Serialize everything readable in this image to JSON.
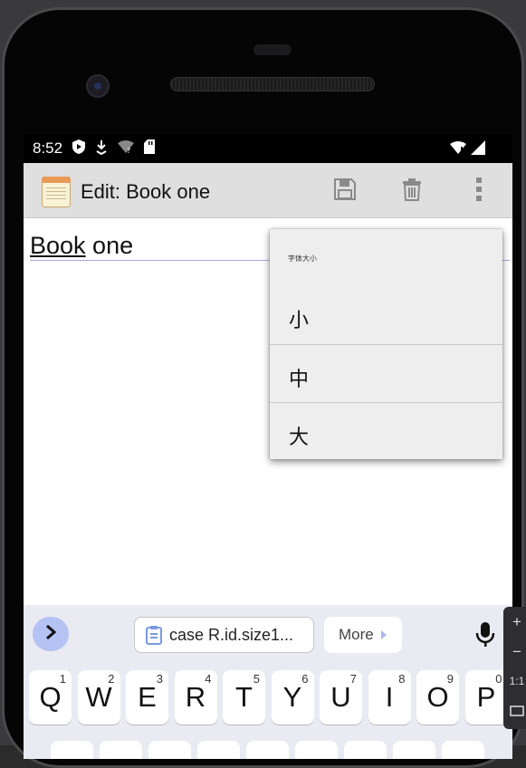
{
  "status_bar": {
    "time": "8:52"
  },
  "app_bar": {
    "title": "Edit: Book one"
  },
  "editor": {
    "title_underlined": "Book",
    "title_rest": " one"
  },
  "popup": {
    "title": "字体大小",
    "options": [
      "小",
      "中",
      "大"
    ]
  },
  "keyboard": {
    "clipboard_text": "case R.id.size1...",
    "more_label": "More",
    "keys": [
      {
        "letter": "Q",
        "hint": "1"
      },
      {
        "letter": "W",
        "hint": "2"
      },
      {
        "letter": "E",
        "hint": "3"
      },
      {
        "letter": "R",
        "hint": "4"
      },
      {
        "letter": "T",
        "hint": "5"
      },
      {
        "letter": "Y",
        "hint": "6"
      },
      {
        "letter": "U",
        "hint": "7"
      },
      {
        "letter": "I",
        "hint": "8"
      },
      {
        "letter": "O",
        "hint": "9"
      },
      {
        "letter": "P",
        "hint": "0"
      }
    ]
  },
  "emulator_panel": {
    "zoom_in": "+",
    "zoom_out": "−",
    "ratio": "1:1"
  },
  "colors": {
    "appbar_bg": "#dfdfdf",
    "popup_bg": "#eeeeee",
    "keyboard_bg": "#e9eaf2",
    "accent_chip": "#b4c2f4"
  }
}
